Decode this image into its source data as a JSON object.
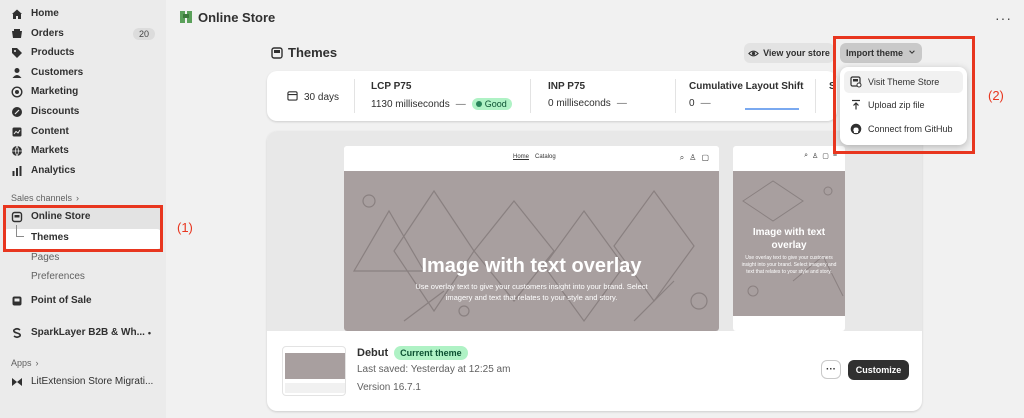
{
  "sidebar": {
    "items": [
      {
        "label": "Home",
        "icon": "home-icon"
      },
      {
        "label": "Orders",
        "icon": "orders-icon",
        "badge": "20"
      },
      {
        "label": "Products",
        "icon": "tag-icon"
      },
      {
        "label": "Customers",
        "icon": "person-icon"
      },
      {
        "label": "Marketing",
        "icon": "target-icon"
      },
      {
        "label": "Discounts",
        "icon": "discount-icon"
      },
      {
        "label": "Content",
        "icon": "content-icon"
      },
      {
        "label": "Markets",
        "icon": "globe-icon"
      },
      {
        "label": "Analytics",
        "icon": "chart-bar-icon"
      }
    ],
    "sales_channels_label": "Sales channels",
    "online_store_label": "Online Store",
    "sub_items": [
      "Themes",
      "Pages",
      "Preferences"
    ],
    "point_of_sale_label": "Point of Sale",
    "sparklayer_label": "SparkLayer B2B & Wh...",
    "apps_label": "Apps",
    "litextension_label": "LitExtension Store Migrati..."
  },
  "annotations": {
    "label_1": "(1)",
    "label_2": "(2)",
    "highlight_color": "#e8361f"
  },
  "header": {
    "title": "Online Store",
    "more": "···"
  },
  "themes_page": {
    "heading": "Themes",
    "view_store_label": "View your store",
    "import_theme_label": "Import theme"
  },
  "metrics": {
    "period": "30 days",
    "lcp": {
      "label": "LCP P75",
      "value": "1130 milliseconds",
      "status": "Good"
    },
    "inp": {
      "label": "INP P75",
      "value": "0 milliseconds"
    },
    "cls": {
      "label": "Cumulative Layout Shift",
      "value": "0"
    },
    "partial": "S"
  },
  "import_menu": {
    "items": [
      {
        "label": "Visit Theme Store",
        "icon": "theme-store-icon"
      },
      {
        "label": "Upload zip file",
        "icon": "upload-icon"
      },
      {
        "label": "Connect from GitHub",
        "icon": "github-icon"
      }
    ]
  },
  "preview": {
    "nav_links": [
      "Home",
      "Catalog"
    ],
    "hero_title": "Image with text overlay",
    "hero_subtitle": "Use overlay text to give your customers insight into your brand. Select imagery and text that relates to your style and story.",
    "mobile_hero_title": "Image with text overlay",
    "mobile_hero_subtitle": "Use overlay text to give your customers insight into your brand. Select imagery and text that relates to your style and story."
  },
  "current_theme": {
    "name": "Debut",
    "badge": "Current theme",
    "last_saved": "Last saved: Yesterday at 12:25 am",
    "version": "Version 16.7.1",
    "more_label": "···",
    "customize_label": "Customize"
  }
}
